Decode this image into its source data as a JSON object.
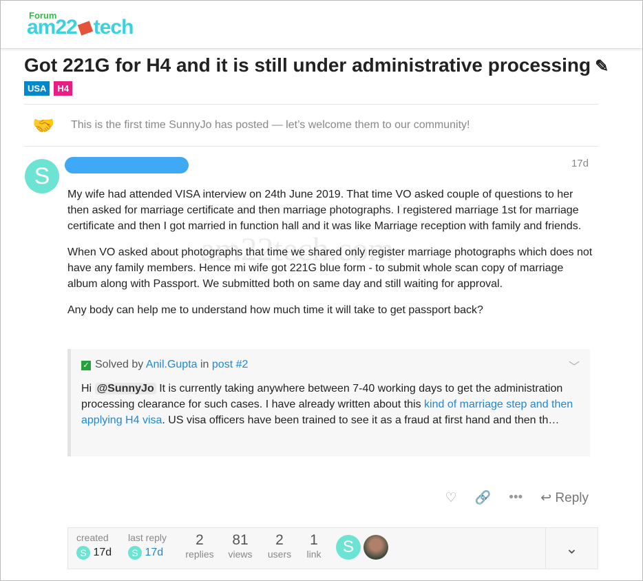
{
  "logo": {
    "forum": "Forum",
    "name_left": "am22",
    "name_right": "tech"
  },
  "topic": {
    "title": "Got 221G for H4 and it is still under administrative processing",
    "tags": [
      {
        "label": "USA",
        "color": "#0088cc"
      },
      {
        "label": "H4",
        "color": "#e91e83"
      }
    ]
  },
  "welcome": "This is the first time SunnyJo has posted — let’s welcome them to our community!",
  "post": {
    "avatar_letter": "S",
    "age": "17d",
    "paragraphs": [
      "My wife had attended VISA interview on 24th June 2019. That time VO asked couple of questions to her then asked for marriage certificate and then marriage photographs. I registered marriage 1st for marriage certificate and then I got married in function hall and it was like Marriage reception with family and friends.",
      "When VO asked about photographs that time we shared only register marriage photographs which does not have any family members. Hence mi wife got 221G blue form - to submit whole scan copy of marriage album along with Passport. We submitted both on same day and still waiting for approval.",
      "Any body can help me to understand how much time it will take to get passport back?"
    ],
    "watermark": "am22tech.com"
  },
  "solved": {
    "prefix": "Solved by",
    "user": "Anil.Gupta",
    "in": "in",
    "post": "post #2",
    "hi": "Hi",
    "mention": "@SunnyJo",
    "text1": "It is currently taking anywhere between 7-40 working days to get the administration processing clearance for such cases. I have already written about this",
    "link": "kind of marriage step and then applying H4 visa",
    "text2": ". US visa officers have been trained to see it as a fraud at first hand and then th…"
  },
  "actions": {
    "reply": "Reply"
  },
  "meta": {
    "created_label": "created",
    "created": "17d",
    "last_reply_label": "last reply",
    "last_reply": "17d",
    "stats": [
      {
        "n": "2",
        "label": "replies"
      },
      {
        "n": "81",
        "label": "views"
      },
      {
        "n": "2",
        "label": "users"
      },
      {
        "n": "1",
        "label": "link"
      }
    ]
  }
}
